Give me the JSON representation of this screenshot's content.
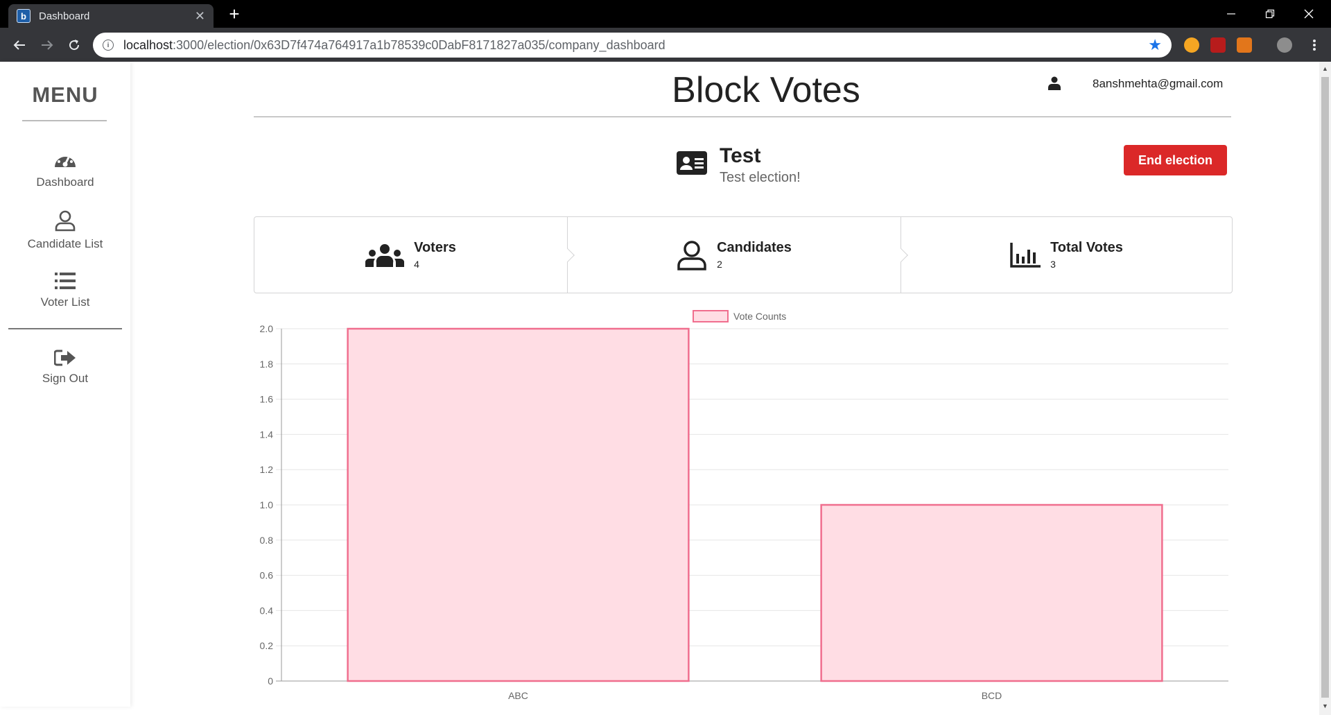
{
  "browser": {
    "tab_title": "Dashboard",
    "tab_favicon": "b",
    "tab_close": "✕",
    "new_tab": "+",
    "url_host": "localhost",
    "url_path": ":3000/election/0x63D7f474a764917a1b78539c0DabF8171827a035/company_dashboard"
  },
  "sidebar": {
    "title": "MENU",
    "items": [
      {
        "label": "Dashboard",
        "icon": "dashboard-gauge-icon"
      },
      {
        "label": "Candidate List",
        "icon": "user-outline-icon"
      },
      {
        "label": "Voter List",
        "icon": "list-icon"
      },
      {
        "label": "Sign Out",
        "icon": "sign-out-icon"
      }
    ]
  },
  "header": {
    "brand": "Block Votes",
    "user_email": "8anshmehta@gmail.com"
  },
  "election": {
    "title": "Test",
    "description": "Test election!",
    "end_button": "End election"
  },
  "stats": [
    {
      "title": "Voters",
      "value": "4",
      "icon": "users-icon"
    },
    {
      "title": "Candidates",
      "value": "2",
      "icon": "user-outline-icon"
    },
    {
      "title": "Total Votes",
      "value": "3",
      "icon": "bar-chart-icon"
    }
  ],
  "colors": {
    "danger": "#db2828",
    "bar_fill": "#ffdde4",
    "bar_border": "#f06e8e"
  },
  "chart_data": {
    "type": "bar",
    "categories": [
      "ABC",
      "BCD"
    ],
    "series": [
      {
        "name": "Vote Counts",
        "values": [
          2,
          1
        ]
      }
    ],
    "ylim": [
      0,
      2
    ],
    "yticks": [
      "0",
      "0.2",
      "0.4",
      "0.6",
      "0.8",
      "1.0",
      "1.2",
      "1.4",
      "1.6",
      "1.8",
      "2.0"
    ],
    "legend": "top-center",
    "grid": true
  }
}
